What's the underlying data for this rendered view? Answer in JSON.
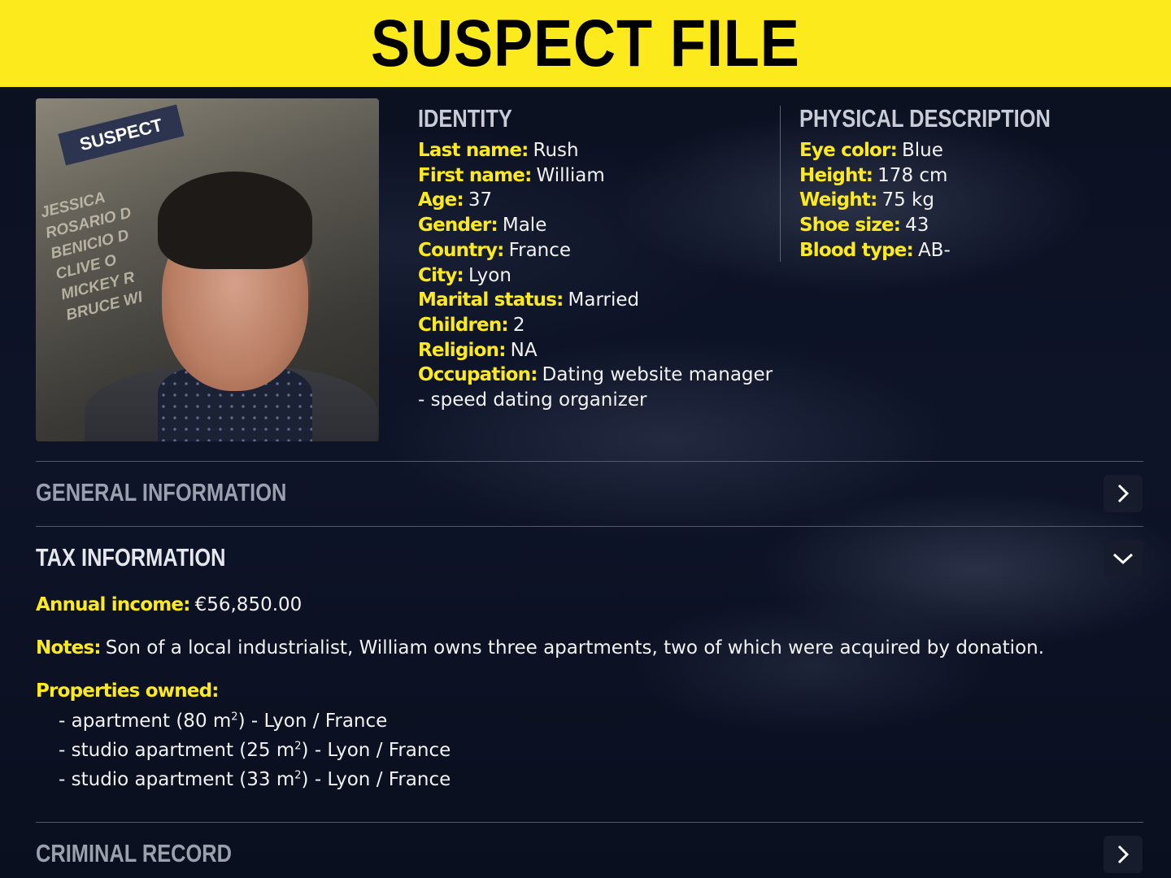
{
  "header": {
    "title": "SUSPECT FILE"
  },
  "photo": {
    "tag": "SUSPECT",
    "poster_lines": [
      "JESSICA",
      "ROSARIO D",
      "BENICIO D",
      "CLIVE O",
      "MICKEY R",
      "BRUCE WI"
    ]
  },
  "identity": {
    "heading": "IDENTITY",
    "fields": [
      {
        "label": "Last name:",
        "value": "Rush"
      },
      {
        "label": "First name:",
        "value": "William"
      },
      {
        "label": "Age:",
        "value": "37"
      },
      {
        "label": "Gender:",
        "value": "Male"
      },
      {
        "label": "Country:",
        "value": "France"
      },
      {
        "label": "City:",
        "value": "Lyon"
      },
      {
        "label": "Marital status:",
        "value": "Married"
      },
      {
        "label": "Children:",
        "value": "2"
      },
      {
        "label": "Religion:",
        "value": "NA"
      },
      {
        "label": "Occupation:",
        "value": "Dating website manager"
      }
    ],
    "occupation_continued": "- speed dating organizer"
  },
  "physical": {
    "heading": "PHYSICAL DESCRIPTION",
    "fields": [
      {
        "label": "Eye color:",
        "value": "Blue"
      },
      {
        "label": "Height:",
        "value": "178 cm"
      },
      {
        "label": "Weight:",
        "value": "75 kg"
      },
      {
        "label": "Shoe size:",
        "value": "43"
      },
      {
        "label": "Blood type:",
        "value": "AB-"
      }
    ]
  },
  "sections": {
    "general": {
      "title": "GENERAL INFORMATION",
      "icon": "chevron-right-icon"
    },
    "tax": {
      "title": "TAX INFORMATION",
      "icon": "chevron-down-icon",
      "income_label": "Annual income:",
      "income_value": "€56,850.00",
      "notes_label": "Notes:",
      "notes_value": "Son of a local industrialist, William owns three apartments, two of which were acquired by donation.",
      "properties_label": "Properties owned:",
      "properties": [
        {
          "type": "- apartment (80 m",
          "unit_sup": "2",
          "rest": ") -  Lyon /  France"
        },
        {
          "type": "- studio apartment (25 m",
          "unit_sup": "2",
          "rest": ") -  Lyon /  France"
        },
        {
          "type": "- studio apartment (33 m",
          "unit_sup": "2",
          "rest": ") -  Lyon /  France"
        }
      ]
    },
    "criminal": {
      "title": "CRIMINAL RECORD",
      "icon": "chevron-right-icon"
    }
  },
  "colors": {
    "accent": "#fdea1c",
    "background": "#0e1428",
    "muted_heading": "#9aa0ad"
  }
}
